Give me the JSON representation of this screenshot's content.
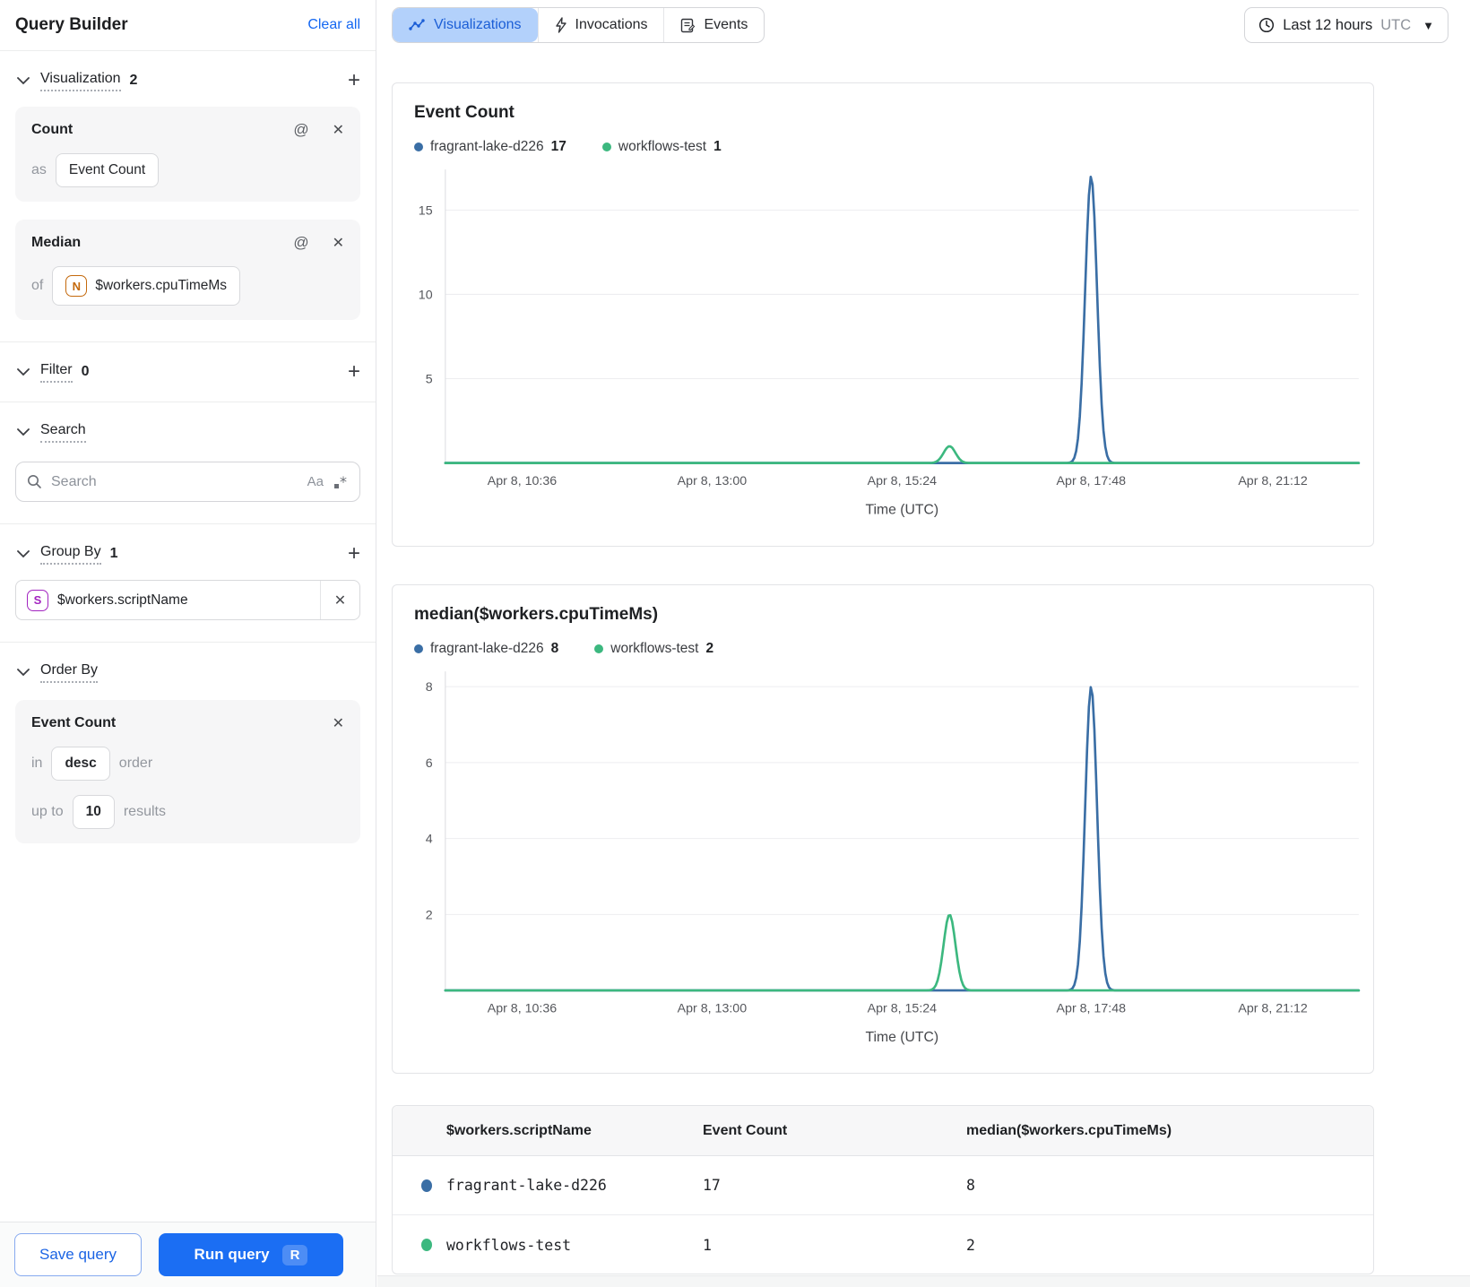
{
  "sidebar": {
    "title": "Query Builder",
    "clear_all": "Clear all",
    "visualization": {
      "label": "Visualization",
      "count": "2",
      "cards": [
        {
          "title": "Count",
          "prefix": "as",
          "value": "Event Count"
        },
        {
          "title": "Median",
          "prefix": "of",
          "field_type": "N",
          "value": "$workers.cpuTimeMs"
        }
      ]
    },
    "filter": {
      "label": "Filter",
      "count": "0"
    },
    "search": {
      "label": "Search",
      "placeholder": "Search",
      "match_case_icon": "Aa"
    },
    "group_by": {
      "label": "Group By",
      "count": "1",
      "field_type": "S",
      "value": "$workers.scriptName"
    },
    "order_by": {
      "label": "Order By",
      "card": {
        "title": "Event Count",
        "in_label": "in",
        "direction": "desc",
        "order_label": "order",
        "upto_label": "up to",
        "limit": "10",
        "results_label": "results"
      }
    },
    "footer": {
      "save_label": "Save query",
      "run_label": "Run query",
      "run_shortcut": "R"
    }
  },
  "tabs": [
    {
      "label": "Visualizations",
      "active": true
    },
    {
      "label": "Invocations",
      "active": false
    },
    {
      "label": "Events",
      "active": false
    }
  ],
  "time_picker": {
    "label": "Last 12 hours",
    "timezone": "UTC"
  },
  "chart_data": [
    {
      "type": "line",
      "title": "Event Count",
      "xlabel": "Time (UTC)",
      "x_ticks": [
        "Apr 8, 10:36",
        "Apr 8, 13:00",
        "Apr 8, 15:24",
        "Apr 8, 17:48",
        "Apr 8, 21:12"
      ],
      "x_tick_pcts": [
        8.4,
        29.2,
        50,
        70.7,
        90.6
      ],
      "y_ticks": [
        5,
        10,
        15
      ],
      "ylim": [
        0,
        17.4
      ],
      "grid": true,
      "legend_position": "top",
      "series": [
        {
          "name": "fragrant-lake-d226",
          "color": "#3a6ea5",
          "total": 17,
          "baseline": 0,
          "peak": {
            "x_pct": 70.7,
            "value": 17,
            "approx_time": "Apr 8, ~17:40"
          }
        },
        {
          "name": "workflows-test",
          "color": "#3cb87f",
          "total": 1,
          "baseline": 0,
          "peak": {
            "x_pct": 55.2,
            "value": 1,
            "approx_time": "Apr 8, ~16:00"
          }
        }
      ]
    },
    {
      "type": "line",
      "title": "median($workers.cpuTimeMs)",
      "xlabel": "Time (UTC)",
      "x_ticks": [
        "Apr 8, 10:36",
        "Apr 8, 13:00",
        "Apr 8, 15:24",
        "Apr 8, 17:48",
        "Apr 8, 21:12"
      ],
      "x_tick_pcts": [
        8.4,
        29.2,
        50,
        70.7,
        90.6
      ],
      "y_ticks": [
        2,
        4,
        6,
        8
      ],
      "ylim": [
        0,
        8.4
      ],
      "grid": true,
      "legend_position": "top",
      "series": [
        {
          "name": "fragrant-lake-d226",
          "color": "#3a6ea5",
          "total": 8,
          "baseline": 0,
          "peak": {
            "x_pct": 70.7,
            "value": 8,
            "approx_time": "Apr 8, ~17:40"
          }
        },
        {
          "name": "workflows-test",
          "color": "#3cb87f",
          "total": 2,
          "baseline": 0,
          "peak": {
            "x_pct": 55.2,
            "value": 2,
            "approx_time": "Apr 8, ~16:00"
          }
        }
      ]
    }
  ],
  "table": {
    "columns": [
      "$workers.scriptName",
      "Event Count",
      "median($workers.cpuTimeMs)"
    ],
    "rows": [
      {
        "color": "#3a6ea5",
        "name": "fragrant-lake-d226",
        "event_count": "17",
        "median": "8"
      },
      {
        "color": "#3cb87f",
        "name": "workflows-test",
        "event_count": "1",
        "median": "2"
      }
    ]
  }
}
